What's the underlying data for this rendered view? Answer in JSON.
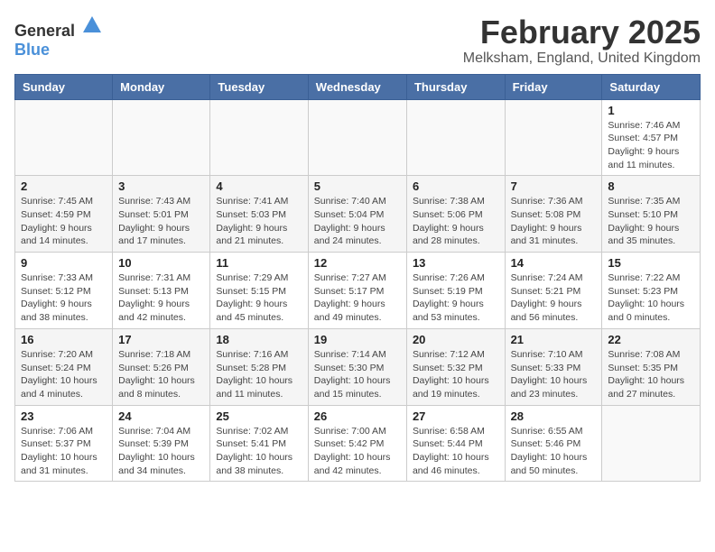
{
  "header": {
    "logo_general": "General",
    "logo_blue": "Blue",
    "month_title": "February 2025",
    "location": "Melksham, England, United Kingdom"
  },
  "days_of_week": [
    "Sunday",
    "Monday",
    "Tuesday",
    "Wednesday",
    "Thursday",
    "Friday",
    "Saturday"
  ],
  "weeks": [
    [
      {
        "day": "",
        "detail": ""
      },
      {
        "day": "",
        "detail": ""
      },
      {
        "day": "",
        "detail": ""
      },
      {
        "day": "",
        "detail": ""
      },
      {
        "day": "",
        "detail": ""
      },
      {
        "day": "",
        "detail": ""
      },
      {
        "day": "1",
        "detail": "Sunrise: 7:46 AM\nSunset: 4:57 PM\nDaylight: 9 hours and 11 minutes."
      }
    ],
    [
      {
        "day": "2",
        "detail": "Sunrise: 7:45 AM\nSunset: 4:59 PM\nDaylight: 9 hours and 14 minutes."
      },
      {
        "day": "3",
        "detail": "Sunrise: 7:43 AM\nSunset: 5:01 PM\nDaylight: 9 hours and 17 minutes."
      },
      {
        "day": "4",
        "detail": "Sunrise: 7:41 AM\nSunset: 5:03 PM\nDaylight: 9 hours and 21 minutes."
      },
      {
        "day": "5",
        "detail": "Sunrise: 7:40 AM\nSunset: 5:04 PM\nDaylight: 9 hours and 24 minutes."
      },
      {
        "day": "6",
        "detail": "Sunrise: 7:38 AM\nSunset: 5:06 PM\nDaylight: 9 hours and 28 minutes."
      },
      {
        "day": "7",
        "detail": "Sunrise: 7:36 AM\nSunset: 5:08 PM\nDaylight: 9 hours and 31 minutes."
      },
      {
        "day": "8",
        "detail": "Sunrise: 7:35 AM\nSunset: 5:10 PM\nDaylight: 9 hours and 35 minutes."
      }
    ],
    [
      {
        "day": "9",
        "detail": "Sunrise: 7:33 AM\nSunset: 5:12 PM\nDaylight: 9 hours and 38 minutes."
      },
      {
        "day": "10",
        "detail": "Sunrise: 7:31 AM\nSunset: 5:13 PM\nDaylight: 9 hours and 42 minutes."
      },
      {
        "day": "11",
        "detail": "Sunrise: 7:29 AM\nSunset: 5:15 PM\nDaylight: 9 hours and 45 minutes."
      },
      {
        "day": "12",
        "detail": "Sunrise: 7:27 AM\nSunset: 5:17 PM\nDaylight: 9 hours and 49 minutes."
      },
      {
        "day": "13",
        "detail": "Sunrise: 7:26 AM\nSunset: 5:19 PM\nDaylight: 9 hours and 53 minutes."
      },
      {
        "day": "14",
        "detail": "Sunrise: 7:24 AM\nSunset: 5:21 PM\nDaylight: 9 hours and 56 minutes."
      },
      {
        "day": "15",
        "detail": "Sunrise: 7:22 AM\nSunset: 5:23 PM\nDaylight: 10 hours and 0 minutes."
      }
    ],
    [
      {
        "day": "16",
        "detail": "Sunrise: 7:20 AM\nSunset: 5:24 PM\nDaylight: 10 hours and 4 minutes."
      },
      {
        "day": "17",
        "detail": "Sunrise: 7:18 AM\nSunset: 5:26 PM\nDaylight: 10 hours and 8 minutes."
      },
      {
        "day": "18",
        "detail": "Sunrise: 7:16 AM\nSunset: 5:28 PM\nDaylight: 10 hours and 11 minutes."
      },
      {
        "day": "19",
        "detail": "Sunrise: 7:14 AM\nSunset: 5:30 PM\nDaylight: 10 hours and 15 minutes."
      },
      {
        "day": "20",
        "detail": "Sunrise: 7:12 AM\nSunset: 5:32 PM\nDaylight: 10 hours and 19 minutes."
      },
      {
        "day": "21",
        "detail": "Sunrise: 7:10 AM\nSunset: 5:33 PM\nDaylight: 10 hours and 23 minutes."
      },
      {
        "day": "22",
        "detail": "Sunrise: 7:08 AM\nSunset: 5:35 PM\nDaylight: 10 hours and 27 minutes."
      }
    ],
    [
      {
        "day": "23",
        "detail": "Sunrise: 7:06 AM\nSunset: 5:37 PM\nDaylight: 10 hours and 31 minutes."
      },
      {
        "day": "24",
        "detail": "Sunrise: 7:04 AM\nSunset: 5:39 PM\nDaylight: 10 hours and 34 minutes."
      },
      {
        "day": "25",
        "detail": "Sunrise: 7:02 AM\nSunset: 5:41 PM\nDaylight: 10 hours and 38 minutes."
      },
      {
        "day": "26",
        "detail": "Sunrise: 7:00 AM\nSunset: 5:42 PM\nDaylight: 10 hours and 42 minutes."
      },
      {
        "day": "27",
        "detail": "Sunrise: 6:58 AM\nSunset: 5:44 PM\nDaylight: 10 hours and 46 minutes."
      },
      {
        "day": "28",
        "detail": "Sunrise: 6:55 AM\nSunset: 5:46 PM\nDaylight: 10 hours and 50 minutes."
      },
      {
        "day": "",
        "detail": ""
      }
    ]
  ]
}
